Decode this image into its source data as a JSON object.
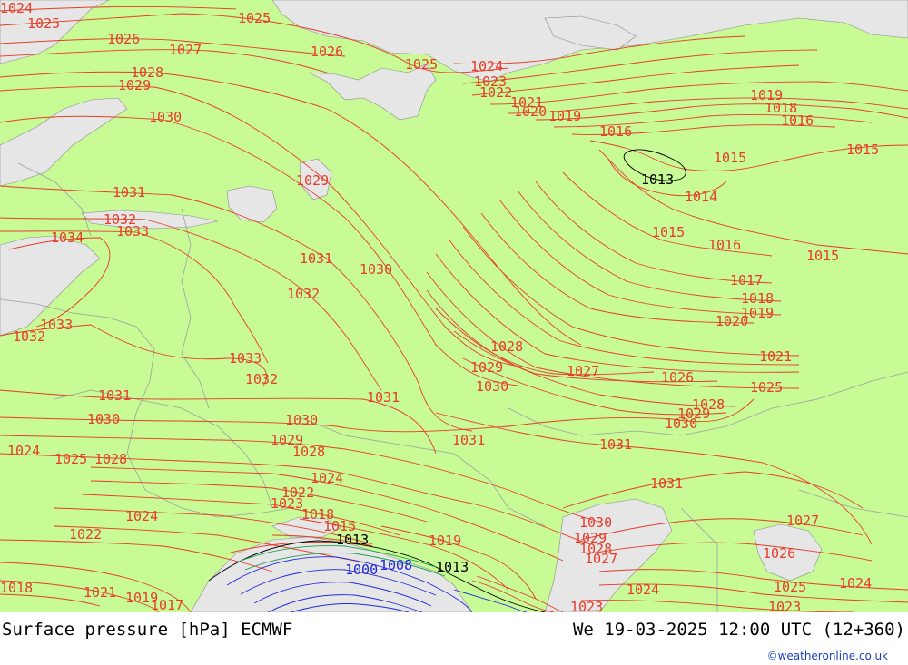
{
  "map": {
    "colors": {
      "land": "#c8fa96",
      "sea": "#e6e6e6",
      "isobar_high": "#e63c28",
      "isobar_mid": "#000000",
      "isobar_low": "#1e28dc",
      "isobar_trough": "#1ea050",
      "border": "#9aa0a0"
    },
    "labels": [
      {
        "text": "1024"
      },
      {
        "text": "1025"
      },
      {
        "text": "1025"
      },
      {
        "text": "1026"
      },
      {
        "text": "1027"
      },
      {
        "text": "1026"
      },
      {
        "text": "1025"
      },
      {
        "text": "1024"
      },
      {
        "text": "1023"
      },
      {
        "text": "1022"
      },
      {
        "text": "1028"
      },
      {
        "text": "1029"
      },
      {
        "text": "1021"
      },
      {
        "text": "1020"
      },
      {
        "text": "1019"
      },
      {
        "text": "1030"
      },
      {
        "text": "1019"
      },
      {
        "text": "1018"
      },
      {
        "text": "1016"
      },
      {
        "text": "1016"
      },
      {
        "text": "1015"
      },
      {
        "text": "1015"
      },
      {
        "text": "1013"
      },
      {
        "text": "1029"
      },
      {
        "text": "1014"
      },
      {
        "text": "1031"
      },
      {
        "text": "1032"
      },
      {
        "text": "1033"
      },
      {
        "text": "1034"
      },
      {
        "text": "1015"
      },
      {
        "text": "1016"
      },
      {
        "text": "1015"
      },
      {
        "text": "1031"
      },
      {
        "text": "1030"
      },
      {
        "text": "1017"
      },
      {
        "text": "1032"
      },
      {
        "text": "1018"
      },
      {
        "text": "1019"
      },
      {
        "text": "1020"
      },
      {
        "text": "1033"
      },
      {
        "text": "1032"
      },
      {
        "text": "1028"
      },
      {
        "text": "1033"
      },
      {
        "text": "1029"
      },
      {
        "text": "1027"
      },
      {
        "text": "1026"
      },
      {
        "text": "1021"
      },
      {
        "text": "1032"
      },
      {
        "text": "1030"
      },
      {
        "text": "1025"
      },
      {
        "text": "1031"
      },
      {
        "text": "1031"
      },
      {
        "text": "1028"
      },
      {
        "text": "1029"
      },
      {
        "text": "1030"
      },
      {
        "text": "1030"
      },
      {
        "text": "1030"
      },
      {
        "text": "1029"
      },
      {
        "text": "1031"
      },
      {
        "text": "1031"
      },
      {
        "text": "1028"
      },
      {
        "text": "1024"
      },
      {
        "text": "1025"
      },
      {
        "text": "1028"
      },
      {
        "text": "1031"
      },
      {
        "text": "1022"
      },
      {
        "text": "1023"
      },
      {
        "text": "1024"
      },
      {
        "text": "1018"
      },
      {
        "text": "1015"
      },
      {
        "text": "1030"
      },
      {
        "text": "1027"
      },
      {
        "text": "1029"
      },
      {
        "text": "1028"
      },
      {
        "text": "1026"
      },
      {
        "text": "1022"
      },
      {
        "text": "1024"
      },
      {
        "text": "1013"
      },
      {
        "text": "1019"
      },
      {
        "text": "1027"
      },
      {
        "text": "1008"
      },
      {
        "text": "1013"
      },
      {
        "text": "1000"
      },
      {
        "text": "1025"
      },
      {
        "text": "1024"
      },
      {
        "text": "1024"
      },
      {
        "text": "1018"
      },
      {
        "text": "1021"
      },
      {
        "text": "1019"
      },
      {
        "text": "1017"
      },
      {
        "text": "1023"
      },
      {
        "text": "1023"
      }
    ]
  },
  "footer": {
    "title": "Surface pressure [hPa] ECMWF",
    "datetime": "We 19-03-2025 12:00 UTC (12+360)",
    "credit": "©weatheronline.co.uk"
  }
}
